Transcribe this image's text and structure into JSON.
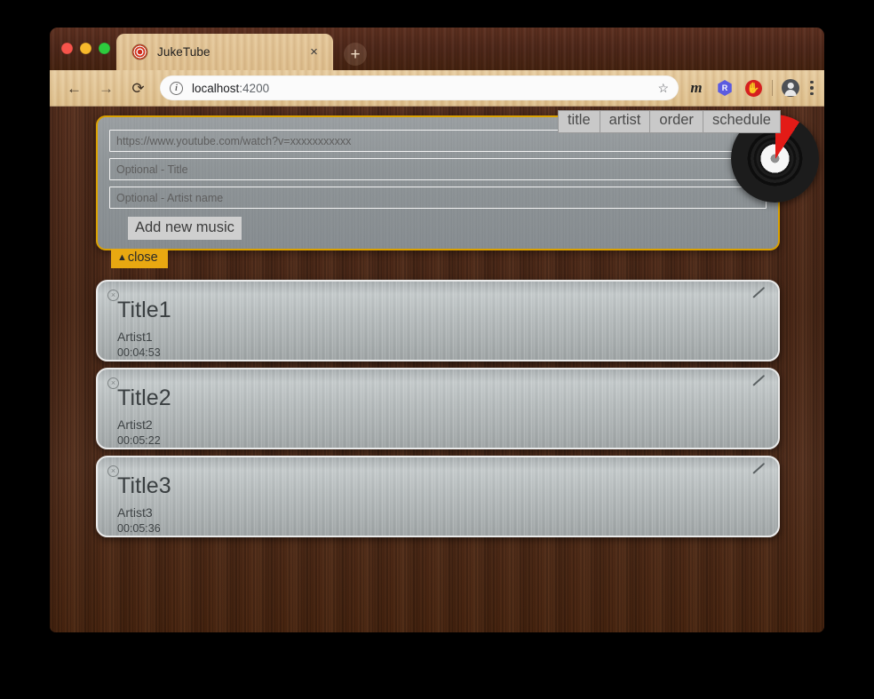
{
  "window": {
    "traffic_lights": [
      "close",
      "minimize",
      "maximize"
    ],
    "tab": {
      "title": "JukeTube",
      "favicon": "target-icon",
      "close_label": "×"
    },
    "new_tab_label": "+"
  },
  "toolbar": {
    "back_label": "←",
    "forward_label": "→",
    "reload_label": "⟳",
    "site_info_label": "i",
    "url_host": "localhost",
    "url_port": ":4200",
    "bookmark_label": "☆",
    "extensions": [
      {
        "name": "ext-m",
        "label": "m"
      },
      {
        "name": "ext-r",
        "label": "R"
      },
      {
        "name": "ext-stop",
        "label": "✋"
      }
    ],
    "profile_label": "",
    "menu_label": ""
  },
  "page": {
    "top_nav": [
      {
        "name": "title",
        "label": "title"
      },
      {
        "name": "artist",
        "label": "artist"
      },
      {
        "name": "order",
        "label": "order"
      },
      {
        "name": "schedule",
        "label": "schedule"
      }
    ],
    "vinyl_record_label": "vinyl-record",
    "add_form": {
      "url_placeholder": "https://www.youtube.com/watch?v=xxxxxxxxxxx",
      "url_value": "",
      "title_placeholder": "Optional - Title",
      "title_value": "",
      "artist_placeholder": "Optional - Artist name",
      "artist_value": "",
      "submit_label": "Add new music"
    },
    "close_tab": {
      "caret": "▲",
      "label": "close"
    },
    "music_items": [
      {
        "title": "Title1",
        "artist": "Artist1",
        "duration": "00:04:53",
        "delete_label": "×"
      },
      {
        "title": "Title2",
        "artist": "Artist2",
        "duration": "00:05:22",
        "delete_label": "×"
      },
      {
        "title": "Title3",
        "artist": "Artist3",
        "duration": "00:05:36",
        "delete_label": "×"
      }
    ]
  },
  "colors": {
    "accent_gold": "#dba100",
    "close_tab_bg": "#e8a811",
    "panel_gray": "#8e9497",
    "card_border": "#e9eaea",
    "wood_dark": "#4b2817",
    "wood_light": "#e0c294",
    "nav_bg": "#c9c9c9",
    "vinyl_red": "#e31b17"
  }
}
